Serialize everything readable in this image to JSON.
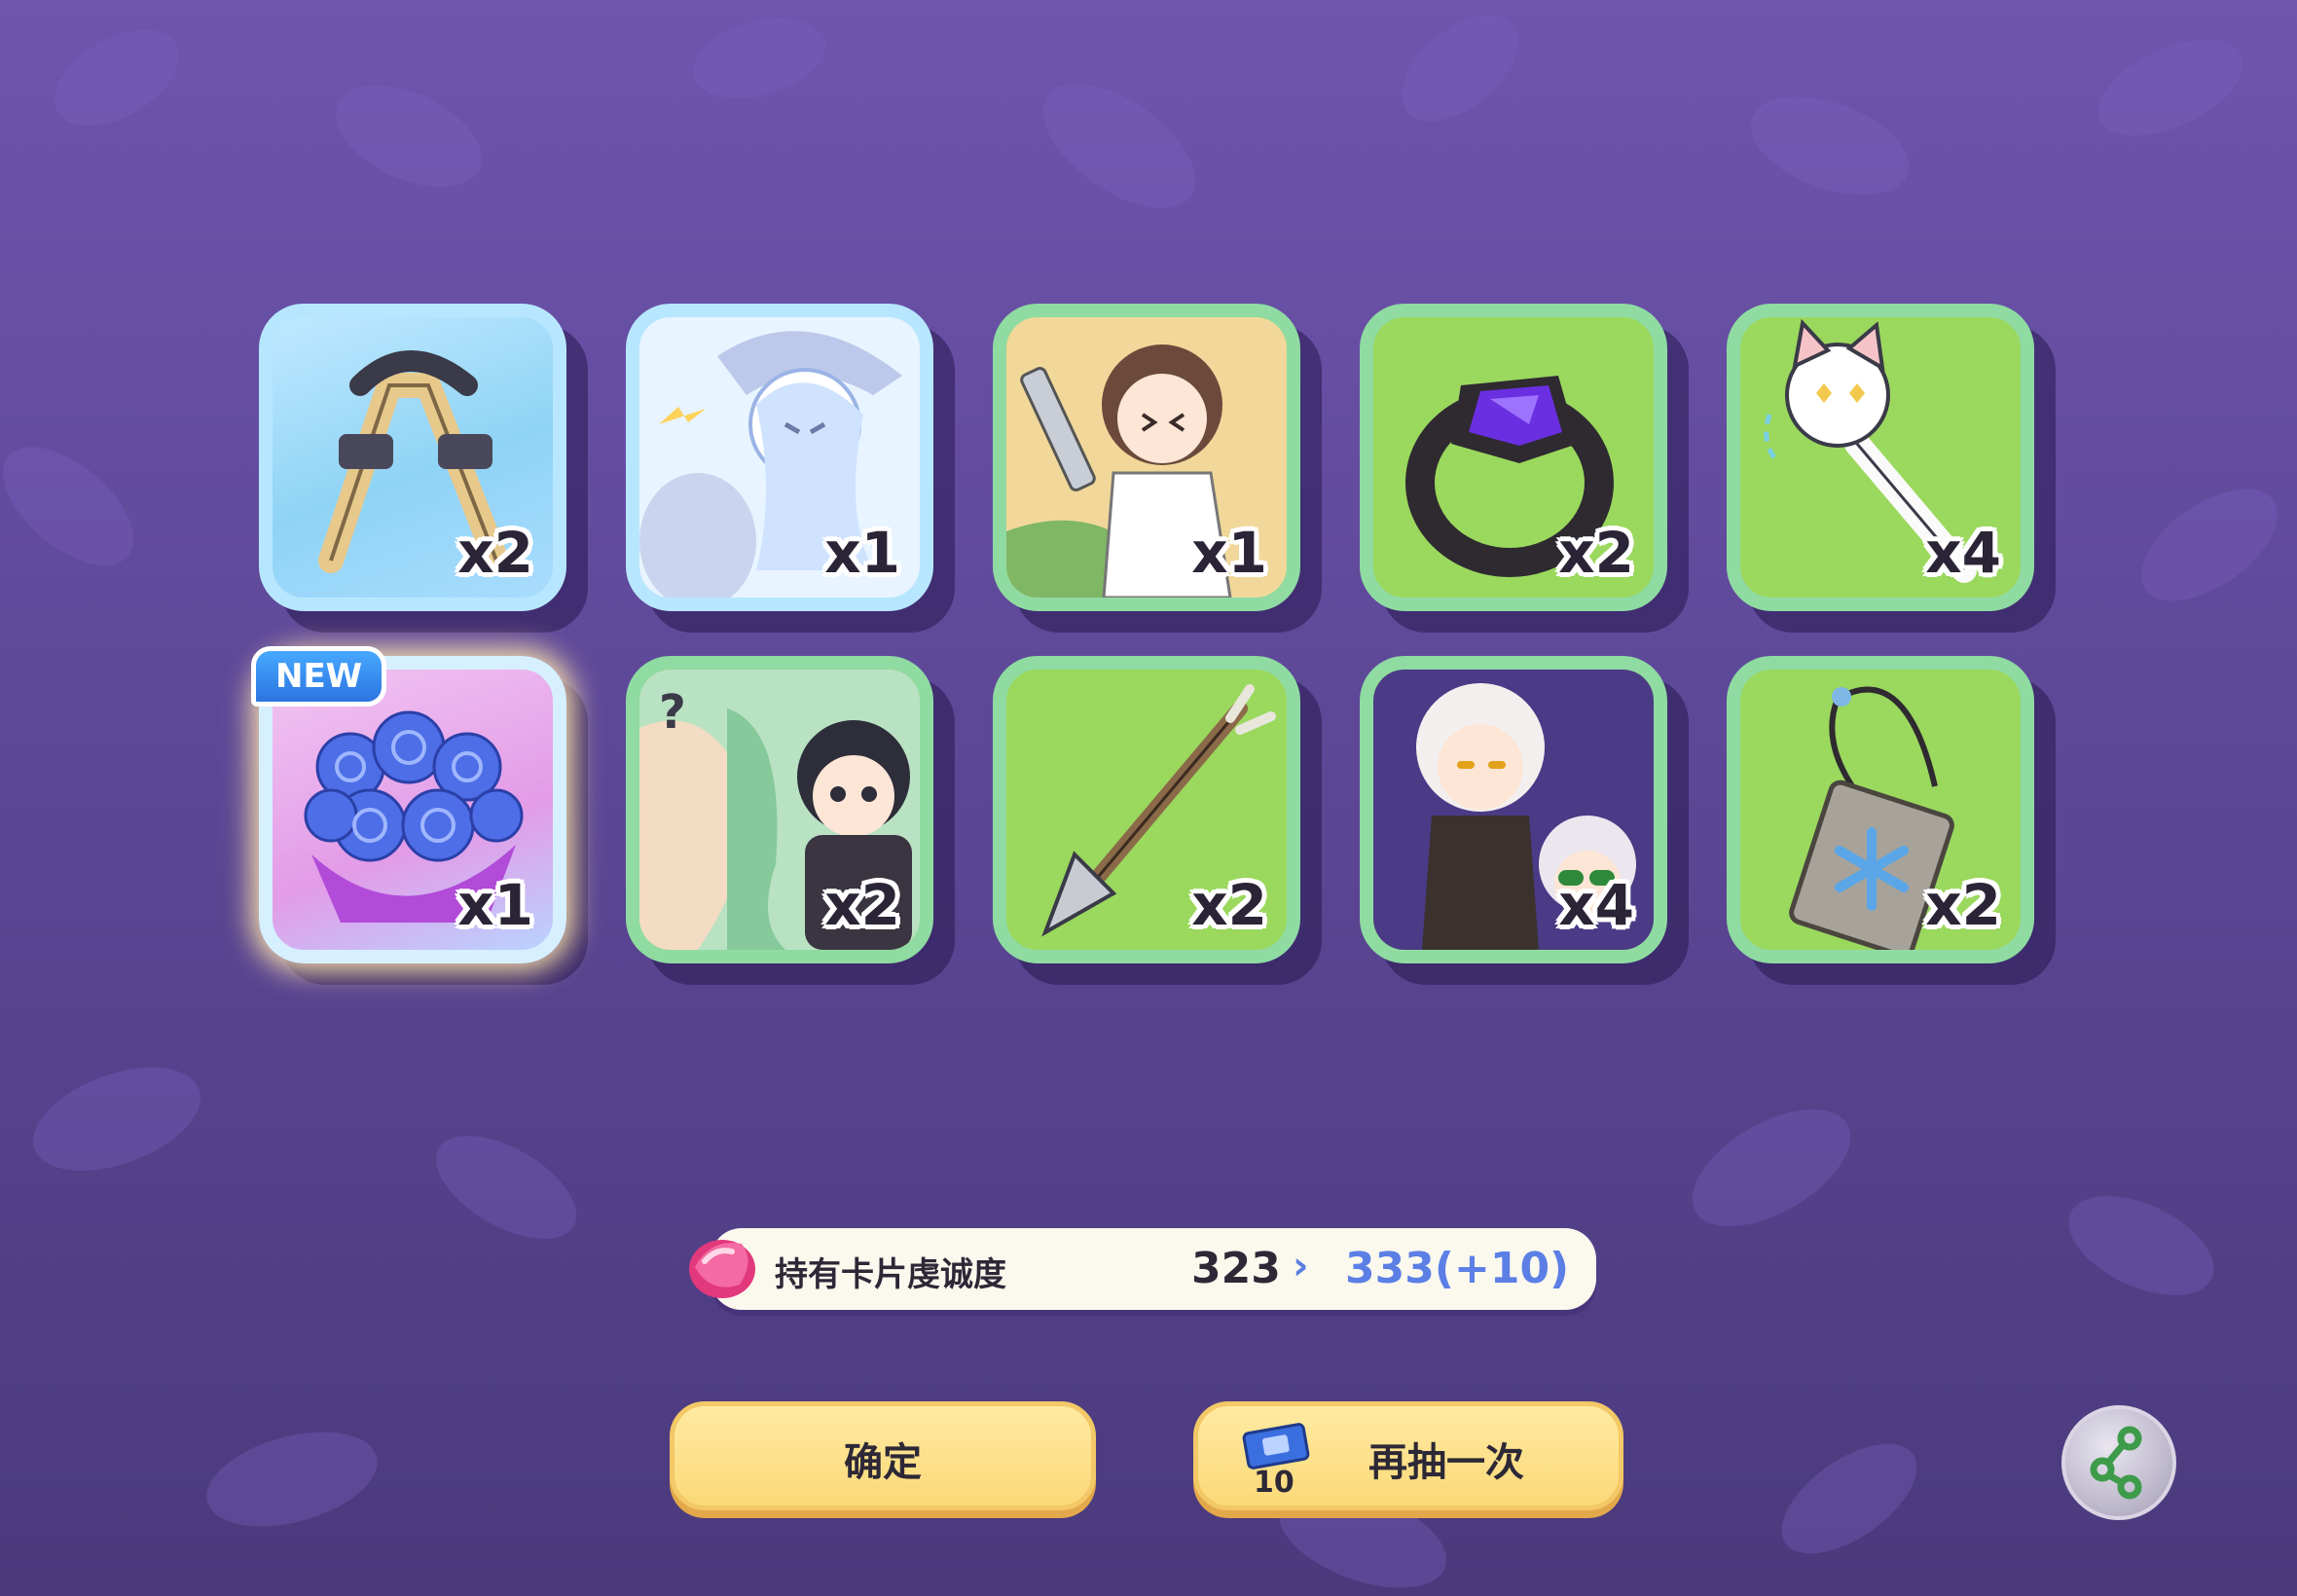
{
  "colors": {
    "background": "#5d4897",
    "card_border_green": "#8fdba2",
    "card_fill_green": "#9bd85e",
    "card_border_blue": "#b7e7ff",
    "button_fill": "#fbd978",
    "accent_blue": "#5c7fe6"
  },
  "cards": [
    {
      "item": "slingshot-icon",
      "quantity": "x2",
      "frame": "blue"
    },
    {
      "item": "card-illustration-witch",
      "quantity": "x1",
      "frame": "blue"
    },
    {
      "item": "card-illustration-sword-girl",
      "quantity": "x1",
      "frame": "green"
    },
    {
      "item": "dark-ring-icon",
      "quantity": "x2",
      "frame": "green"
    },
    {
      "item": "cat-wand-icon",
      "quantity": "x4",
      "frame": "green"
    },
    {
      "item": "blue-rose-bouquet-icon",
      "quantity": "x1",
      "frame": "pink",
      "badge": "NEW"
    },
    {
      "item": "card-illustration-surprise",
      "quantity": "x2",
      "frame": "green"
    },
    {
      "item": "spear-icon",
      "quantity": "x2",
      "frame": "green"
    },
    {
      "item": "card-illustration-duo",
      "quantity": "x4",
      "frame": "green"
    },
    {
      "item": "snowflake-pendant-icon",
      "quantity": "x2",
      "frame": "green"
    }
  ],
  "favor": {
    "icon": "pink-gem-icon",
    "label": "持有卡片虔诚度",
    "current": "323",
    "arrow": "›",
    "next": "333(+10)"
  },
  "buttons": {
    "confirm": "确定",
    "draw_again": "再抽一次",
    "ticket_icon": "ticket-icon",
    "ticket_cost": "10",
    "share_icon": "share-icon"
  }
}
